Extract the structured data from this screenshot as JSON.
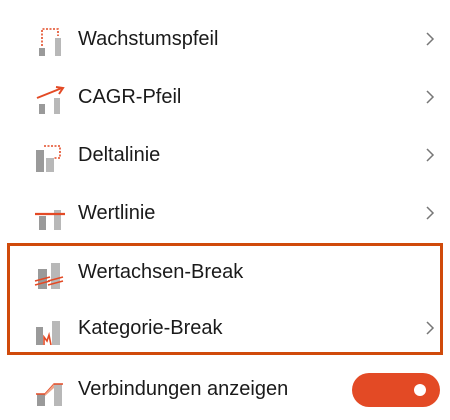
{
  "menu": {
    "items": [
      {
        "label": "Wachstumspfeil",
        "icon": "growth-arrow-icon",
        "has_submenu": true
      },
      {
        "label": "CAGR-Pfeil",
        "icon": "cagr-arrow-icon",
        "has_submenu": true
      },
      {
        "label": "Deltalinie",
        "icon": "delta-line-icon",
        "has_submenu": true
      },
      {
        "label": "Wertlinie",
        "icon": "value-line-icon",
        "has_submenu": true
      },
      {
        "label": "Wertachsen-Break",
        "icon": "value-axis-break-icon",
        "has_submenu": false
      },
      {
        "label": "Kategorie-Break",
        "icon": "category-break-icon",
        "has_submenu": true
      },
      {
        "label": "Verbindungen anzeigen",
        "icon": "connections-icon",
        "has_submenu": false,
        "toggle": {
          "state": "on"
        }
      }
    ]
  },
  "colors": {
    "accent": "#d04a0b",
    "icon_red": "#e34a25",
    "icon_gray": "#9a9a9a",
    "toggle_on": "#e34a25"
  }
}
